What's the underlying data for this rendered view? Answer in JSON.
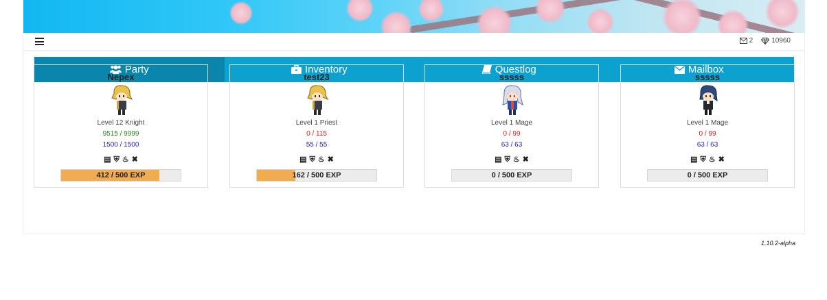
{
  "header": {
    "mail_count": "2",
    "gems": "10960",
    "icons": [
      "menu-icon",
      "envelope-icon",
      "diamond-icon"
    ]
  },
  "tabs": [
    {
      "label": "Party",
      "icon": "users-icon",
      "active": true
    },
    {
      "label": "Inventory",
      "icon": "briefcase-icon",
      "active": false
    },
    {
      "label": "Questlog",
      "icon": "book-icon",
      "active": false
    },
    {
      "label": "Mailbox",
      "icon": "envelope-icon",
      "active": false
    }
  ],
  "party": [
    {
      "name": "Nepex",
      "level": "Level 12 Knight",
      "hp": "9515 / 9999",
      "hp_color": "#2e7d1e",
      "mp": "1500 / 1500",
      "exp": "412 / 500 EXP",
      "exp_fraction": 0.824,
      "sprite": "blonde-hair"
    },
    {
      "name": "test23",
      "level": "Level 1 Priest",
      "hp": "0 / 115",
      "hp_color": "#e01b1b",
      "mp": "55 / 55",
      "exp": "162 / 500 EXP",
      "exp_fraction": 0.324,
      "sprite": "blonde-hair"
    },
    {
      "name": "sssss",
      "level": "Level 1 Mage",
      "hp": "0 / 99",
      "hp_color": "#e01b1b",
      "mp": "63 / 63",
      "exp": "0 / 500 EXP",
      "exp_fraction": 0,
      "sprite": "silver-hair"
    },
    {
      "name": "sssss",
      "level": "Level 1 Mage",
      "hp": "0 / 99",
      "hp_color": "#e01b1b",
      "mp": "63 / 63",
      "exp": "0 / 500 EXP",
      "exp_fraction": 0,
      "sprite": "navy-hair"
    }
  ],
  "card_actions": [
    "stats-icon",
    "shield-icon",
    "fire-icon",
    "remove-icon"
  ],
  "version": "1.10.2-alpha",
  "colors": {
    "tab_bg": "#0da1cf",
    "tab_active": "#0a86ad",
    "exp_fill": "#f0ac4e",
    "mp": "#2525c8"
  }
}
